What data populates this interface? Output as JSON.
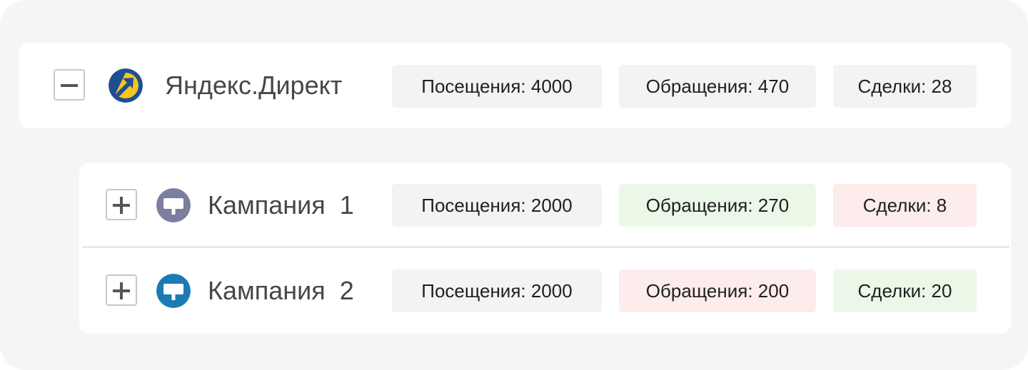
{
  "colors": {
    "neutral_pill": "#f3f3f3",
    "positive_pill": "#ebf8e8",
    "negative_pill": "#fdecec",
    "campaign_1_logo": "#7a7e9f",
    "campaign_2_logo": "#1c7bb3",
    "yandex_logo_bg": "#1e4f94",
    "yandex_logo_arrow": "#f6c521"
  },
  "source": {
    "title": "Яндекс.Директ",
    "logo_icon": "yandex-direct-logo-icon",
    "toggle_state": "expanded",
    "toggle_icon": "minus-icon",
    "metrics": {
      "visits": "Посещения: 4000",
      "requests": "Обращения: 470",
      "deals": "Сделки: 28"
    }
  },
  "campaigns": [
    {
      "title": "Кампания  1",
      "logo_icon": "campaign-signboard-icon",
      "toggle_state": "collapsed",
      "toggle_icon": "plus-icon",
      "metrics": {
        "visits": "Посещения: 2000",
        "requests": "Обращения: 270",
        "deals": "Сделки: 8"
      },
      "metric_status": {
        "visits": "neutral",
        "requests": "positive",
        "deals": "negative"
      }
    },
    {
      "title": "Кампания  2",
      "logo_icon": "campaign-signboard-icon",
      "toggle_state": "collapsed",
      "toggle_icon": "plus-icon",
      "metrics": {
        "visits": "Посещения: 2000",
        "requests": "Обращения: 200",
        "deals": "Сделки: 20"
      },
      "metric_status": {
        "visits": "neutral",
        "requests": "negative",
        "deals": "positive"
      }
    }
  ]
}
